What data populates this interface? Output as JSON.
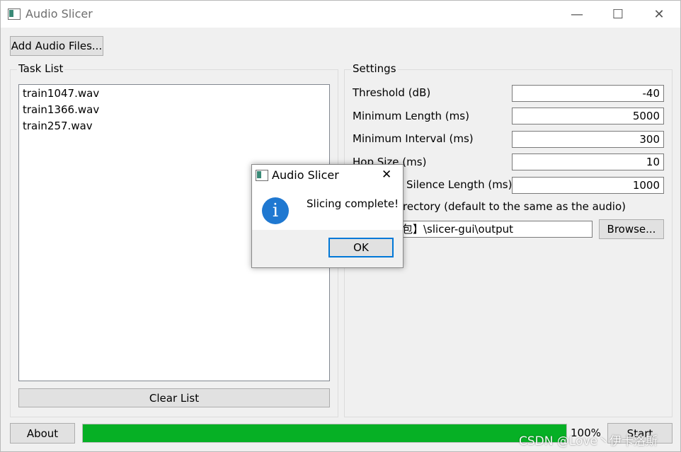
{
  "window": {
    "title": "Audio Slicer",
    "minimize": "—",
    "maximize": "☐",
    "close": "✕"
  },
  "toolbar": {
    "add_files_label": "Add Audio Files..."
  },
  "task_list": {
    "title": "Task List",
    "items": [
      "train1047.wav",
      "train1366.wav",
      "train257.wav"
    ],
    "clear_label": "Clear List"
  },
  "settings": {
    "title": "Settings",
    "fields": [
      {
        "label": "Threshold (dB)",
        "value": "-40"
      },
      {
        "label": "Minimum Length (ms)",
        "value": "5000"
      },
      {
        "label": "Minimum Interval (ms)",
        "value": "300"
      },
      {
        "label": "Hop Size (ms)",
        "value": "10"
      },
      {
        "label": "Silence Length (ms)",
        "value": "1000"
      }
    ],
    "output_label": "rectory (default to the same as the audio)",
    "output_value": "包】\\slicer-gui\\output",
    "browse_label": "Browse..."
  },
  "bottom": {
    "about_label": "About",
    "progress_percent": 100,
    "progress_text": "100%",
    "start_label": "Start"
  },
  "dialog": {
    "title": "Audio Slicer",
    "close": "✕",
    "icon": "info-icon",
    "message": "Slicing complete!",
    "ok_label": "OK"
  },
  "watermark": "CSDN @Love丶伊卡洛斯",
  "colors": {
    "progress": "#06b025",
    "info": "#1f78d1",
    "focus": "#0078d7"
  }
}
